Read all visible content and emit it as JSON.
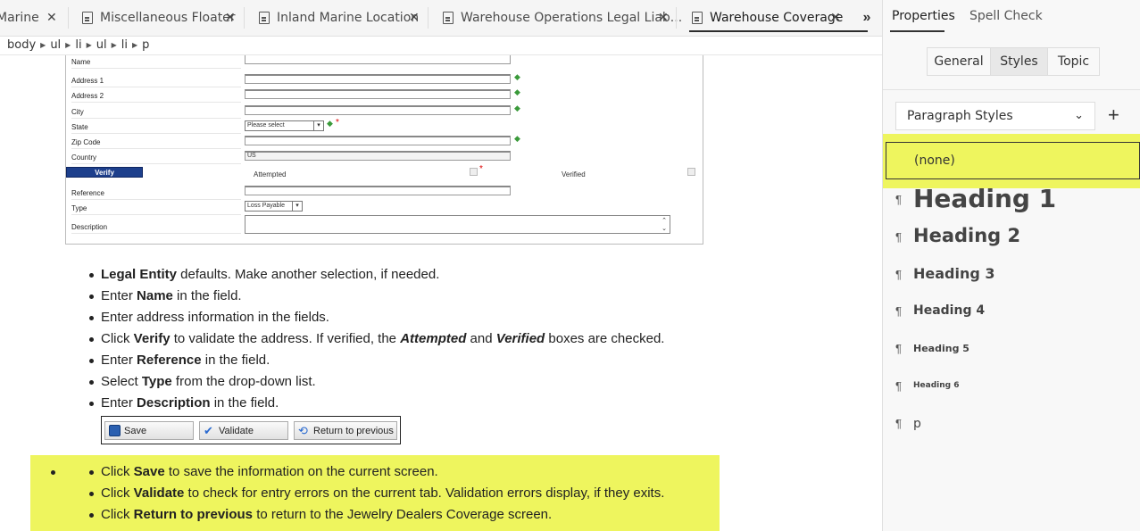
{
  "tabs": [
    {
      "label": "Marine",
      "close": "✕"
    },
    {
      "label": "Miscellaneous Floater",
      "close": "✕"
    },
    {
      "label": "Inland Marine Location",
      "close": "✕"
    },
    {
      "label": "Warehouse Operations Legal Liab...",
      "close": "✕"
    },
    {
      "label": "Warehouse Coverage",
      "close": "✕"
    }
  ],
  "overflow_label": "»",
  "breadcrumb": [
    "body",
    "ul",
    "li",
    "ul",
    "li",
    "p"
  ],
  "breadcrumb_sep": "▶",
  "form": {
    "labels": {
      "name": "Name",
      "address1": "Address 1",
      "address2": "Address 2",
      "city": "City",
      "state": "State",
      "zip": "Zip Code",
      "country": "Country",
      "reference": "Reference",
      "type": "Type",
      "description": "Description"
    },
    "state_value": "Please select",
    "country_value": "US",
    "type_value": "Loss Payable",
    "verify_label": "Verify",
    "attempted_label": "Attempted",
    "verified_label": "Verified",
    "green_marker": "◆",
    "required_marker": "*"
  },
  "steps": [
    {
      "b": "Legal Entity",
      "pre": "",
      "post": " defaults. Make another selection, if needed."
    },
    {
      "pre": "Enter ",
      "b": "Name",
      "post": " in the field."
    },
    {
      "pre": "Enter address information in the fields.",
      "b": "",
      "post": ""
    },
    {
      "pre": "Click ",
      "b": "Verify",
      "post": " to validate the address. If verified, the ",
      "bi1": "Attempted",
      "mid": " and ",
      "bi2": "Verified",
      "tail": " boxes are checked."
    },
    {
      "pre": "Enter ",
      "b": "Reference",
      "post": " in the field."
    },
    {
      "pre": "Select ",
      "b": "Type",
      "post": " from the drop-down list."
    },
    {
      "pre": "Enter ",
      "b": "Description",
      "post": " in the field."
    }
  ],
  "buttons": {
    "save": "Save",
    "validate": "Validate",
    "return": "Return to previous"
  },
  "steps2": [
    {
      "pre": "Click ",
      "b": "Save",
      "post": " to save the information on the current screen."
    },
    {
      "pre": "Click ",
      "b": "Validate",
      "post": " to check for entry errors on the current tab. Validation errors display, if they exits."
    },
    {
      "pre": "Click ",
      "b": "Return to previous",
      "post": " to return to the Jewelry Dealers Coverage screen."
    }
  ],
  "panel": {
    "tabs": [
      "Properties",
      "Spell Check"
    ],
    "segments": [
      "General",
      "Styles",
      "Topic"
    ],
    "dropdown_label": "Paragraph Styles",
    "dropdown_chevron": "⌄",
    "add_label": "+",
    "pilcrow": "¶",
    "styles": [
      "(none)",
      "Heading 1",
      "Heading 2",
      "Heading 3",
      "Heading 4",
      "Heading 5",
      "Heading 6",
      "p"
    ]
  },
  "colors": {
    "highlight": "#eef55e",
    "verify_button": "#1d3f8c"
  }
}
